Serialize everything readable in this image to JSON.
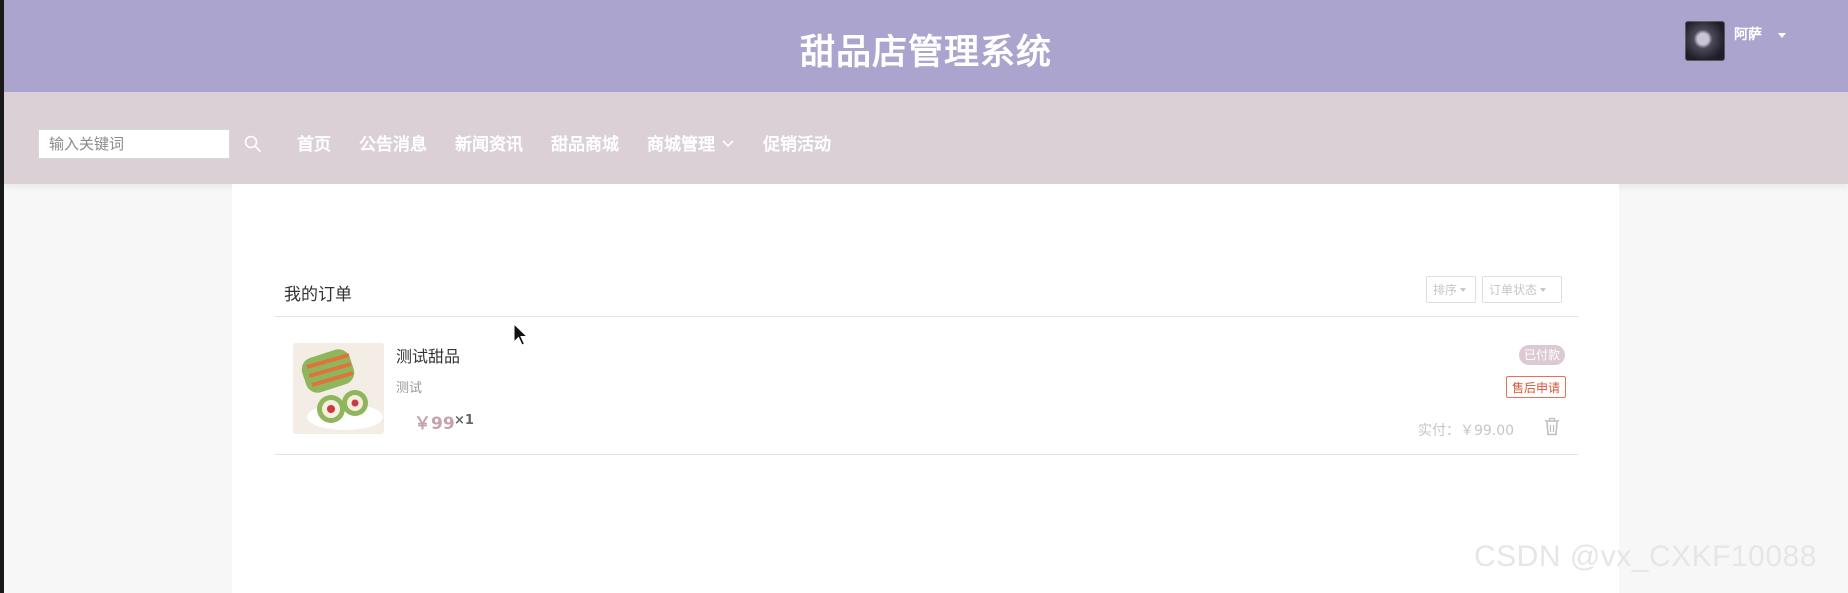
{
  "header": {
    "title": "甜品店管理系统",
    "username": "阿萨",
    "background_color": "#aaa4cf"
  },
  "navbar": {
    "search_placeholder": "输入关键词",
    "items": [
      {
        "label": "首页"
      },
      {
        "label": "公告消息"
      },
      {
        "label": "新闻资讯"
      },
      {
        "label": "甜品商城"
      },
      {
        "label": "商城管理",
        "has_dropdown": true
      },
      {
        "label": "促销活动"
      }
    ],
    "background_color": "#dcd0d7"
  },
  "orders": {
    "title": "我的订单",
    "sort_label": "排序",
    "status_filter_label": "订单状态",
    "items": [
      {
        "name": "测试甜品",
        "description": "测试",
        "price": "￥99",
        "quantity": "×1",
        "status_badge": "已付款",
        "after_sale_button": "售后申请",
        "paid_text": "实付：￥99.00"
      }
    ]
  },
  "watermark": "CSDN @vx_CXKF10088",
  "colors": {
    "accent_purple": "#aaa4cf",
    "nav_pink": "#dcd0d7",
    "price_pink": "#c3a3ad",
    "after_sale_orange": "#d9553a"
  }
}
